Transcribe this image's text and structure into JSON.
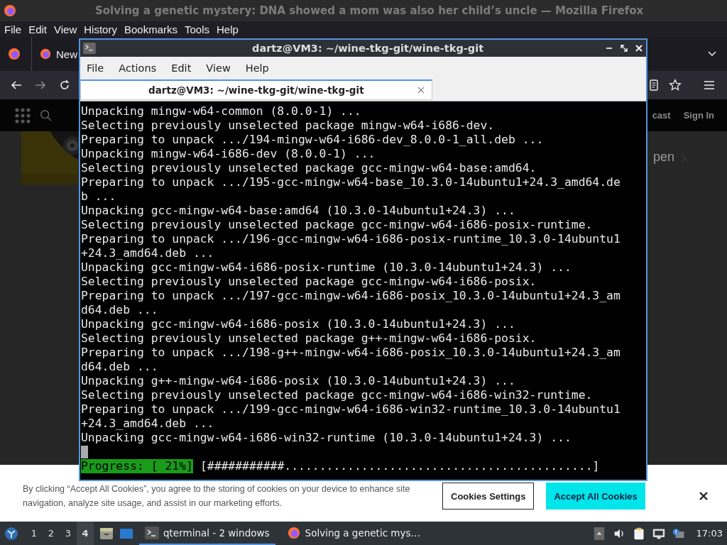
{
  "firefox": {
    "title": "Solving a genetic mystery: DNA showed a mom was also her child’s uncle — Mozilla Firefox",
    "menu": [
      "File",
      "Edit",
      "View",
      "History",
      "Bookmarks",
      "Tools",
      "Help"
    ],
    "tab": {
      "label": "New"
    },
    "page_nav": [
      "cast",
      "Sign In"
    ],
    "page_link": "pen"
  },
  "cookie_banner": {
    "text": "By clicking “Accept All Cookies”, you agree to the storing of cookies on your device to enhance site navigation, analyze site usage, and assist in our marketing efforts.",
    "buttons": [
      {
        "label": "Cookies Settings",
        "kind": "secondary"
      },
      {
        "label": "Accept All Cookies",
        "kind": "primary"
      }
    ]
  },
  "terminal": {
    "title": "dartz@VM3: ~/wine-tkg-git/wine-tkg-git",
    "menu": [
      "File",
      "Actions",
      "Edit",
      "View",
      "Help"
    ],
    "tab": {
      "title": "dartz@VM3: ~/wine-tkg-git/wine-tkg-git",
      "selected": true
    },
    "lines": [
      "Unpacking mingw-w64-common (8.0.0-1) ...",
      "Selecting previously unselected package mingw-w64-i686-dev.",
      "Preparing to unpack .../194-mingw-w64-i686-dev_8.0.0-1_all.deb ...",
      "Unpacking mingw-w64-i686-dev (8.0.0-1) ...",
      "Selecting previously unselected package gcc-mingw-w64-base:amd64.",
      "Preparing to unpack .../195-gcc-mingw-w64-base_10.3.0-14ubuntu1+24.3_amd64.de",
      "b ...",
      "Unpacking gcc-mingw-w64-base:amd64 (10.3.0-14ubuntu1+24.3) ...",
      "Selecting previously unselected package gcc-mingw-w64-i686-posix-runtime.",
      "Preparing to unpack .../196-gcc-mingw-w64-i686-posix-runtime_10.3.0-14ubuntu1",
      "+24.3_amd64.deb ...",
      "Unpacking gcc-mingw-w64-i686-posix-runtime (10.3.0-14ubuntu1+24.3) ...",
      "Selecting previously unselected package gcc-mingw-w64-i686-posix.",
      "Preparing to unpack .../197-gcc-mingw-w64-i686-posix_10.3.0-14ubuntu1+24.3_am",
      "d64.deb ...",
      "Unpacking gcc-mingw-w64-i686-posix (10.3.0-14ubuntu1+24.3) ...",
      "Selecting previously unselected package g++-mingw-w64-i686-posix.",
      "Preparing to unpack .../198-g++-mingw-w64-i686-posix_10.3.0-14ubuntu1+24.3_am",
      "d64.deb ...",
      "Unpacking g++-mingw-w64-i686-posix (10.3.0-14ubuntu1+24.3) ...",
      "Selecting previously unselected package gcc-mingw-w64-i686-win32-runtime.",
      "Preparing to unpack .../199-gcc-mingw-w64-i686-win32-runtime_10.3.0-14ubuntu1",
      "+24.3_amd64.deb ...",
      "Unpacking gcc-mingw-w64-i686-win32-runtime (10.3.0-14ubuntu1+24.3) ..."
    ],
    "progress": {
      "label": "Progress: [ 21%]",
      "bar": "[###########............................................]"
    }
  },
  "taskbar": {
    "workspaces": [
      {
        "label": "1",
        "selected": false
      },
      {
        "label": "2",
        "selected": false
      },
      {
        "label": "3",
        "selected": false
      },
      {
        "label": "4",
        "selected": true
      }
    ],
    "tasks": [
      {
        "label": "qterminal - 2 windows",
        "kind": "terminal",
        "selected": true
      },
      {
        "label": "Solving a genetic mys…",
        "kind": "browser",
        "selected": false
      }
    ],
    "clock": "17:03"
  }
}
